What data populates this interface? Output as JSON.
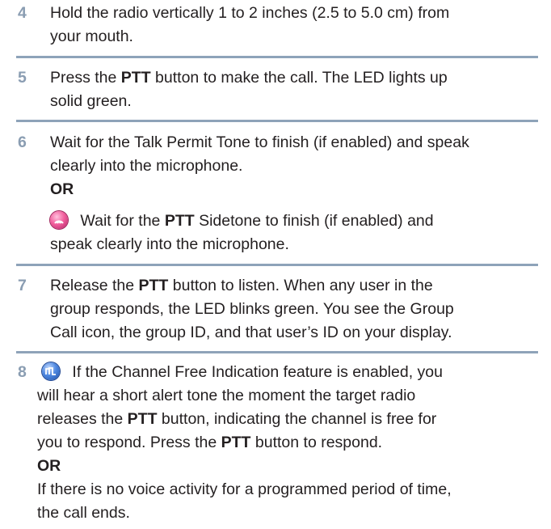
{
  "steps": [
    {
      "number": "4",
      "lines": [
        "Hold the radio vertically 1 to 2 inches (2.5 to 5.0 cm) from",
        "your mouth."
      ]
    },
    {
      "number": "5",
      "line1": {
        "pre": "Press the ",
        "bold": "PTT",
        "post": " button to make the call. The LED lights up"
      },
      "line2": "solid green."
    },
    {
      "number": "6",
      "lines": [
        "Wait for the Talk Permit Tone to finish (if enabled) and speak",
        "clearly into the microphone."
      ],
      "or": "OR",
      "alt_line1": {
        "pre": " Wait for the ",
        "bold": "PTT",
        "post": " Sidetone to finish (if enabled) and"
      },
      "alt_line2": "speak clearly into the microphone."
    },
    {
      "number": "7",
      "line1": {
        "pre": "Release the ",
        "bold": "PTT",
        "post": " button to listen. When any user in the"
      },
      "line2": "group responds, the LED blinks green. You see the Group",
      "line3": "Call icon, the group ID, and that user’s ID on your display."
    },
    {
      "number": "8",
      "line1": " If the Channel Free Indication feature is enabled, you",
      "line2": "will hear a short alert tone the moment the target radio",
      "line3": {
        "pre": "releases the ",
        "bold": "PTT",
        "post": " button, indicating the channel is free for"
      },
      "line4": {
        "pre": "you to respond. Press the ",
        "bold": "PTT",
        "post": " button to respond."
      },
      "or": "OR",
      "line5": "If there is no voice activity for a programmed period of time,",
      "line6": "the call ends."
    }
  ],
  "icons": {
    "sidetone": "capacity-plus-icon",
    "channel_free": "channel-free-icon",
    "accent_color": "#8ea3b9"
  }
}
